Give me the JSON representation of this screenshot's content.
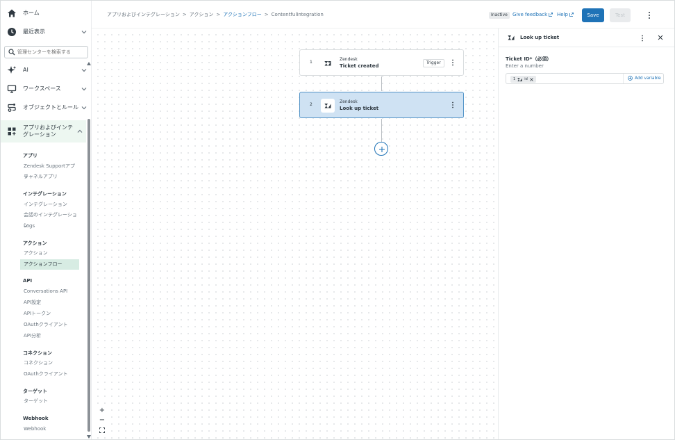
{
  "sidebar": {
    "home": "ホーム",
    "recent": "最近表示",
    "search_placeholder": "管理センターを検索する",
    "ai": "AI",
    "workspace": "ワークスペース",
    "objects": "オブジェクトとルール",
    "apps": "アプリおよびインテグレーション",
    "sections": {
      "apps_head": "アプリ",
      "apps_items": [
        "Zendesk Supportアプリ",
        "チャネルアプリ"
      ],
      "integrations_head": "インテグレーション",
      "integrations_items": [
        "インテグレーション",
        "会話のインテグレーション",
        "Logs"
      ],
      "actions_head": "アクション",
      "actions_items": [
        "アクション",
        "アクションフロー"
      ],
      "api_head": "API",
      "api_items": [
        "Conversations API",
        "API設定",
        "APIトークン",
        "OAuthクライアント",
        "API分析"
      ],
      "connections_head": "コネクション",
      "connections_items": [
        "コネクション",
        "OAuthクライアント"
      ],
      "targets_head": "ターゲット",
      "targets_items": [
        "ターゲット"
      ],
      "webhook_head": "Webhook",
      "webhook_items": [
        "Webhook"
      ]
    }
  },
  "topbar": {
    "breadcrumb": [
      "アプリおよびインテグレーション",
      "アクション",
      "アクションフロー",
      "ContentfulIntegration"
    ],
    "status": "Inactive",
    "feedback": "Give feedback",
    "help": "Help",
    "save": "Save",
    "test": "Test"
  },
  "flow": {
    "steps": [
      {
        "num": "1",
        "app": "Zendesk",
        "name": "Ticket created",
        "tag": "Trigger"
      },
      {
        "num": "2",
        "app": "Zendesk",
        "name": "Look up ticket"
      }
    ],
    "zoom_in": "+",
    "zoom_out": "−"
  },
  "panel": {
    "title": "Look up ticket",
    "field_label": "Ticket ID*（必須）",
    "field_hint": "Enter a number",
    "pill_num": "1",
    "pill_text": "id",
    "add_variable": "Add variable"
  },
  "colors": {
    "accent": "#1f73b7",
    "active_nav": "#edf7f1",
    "selected_step": "#cfe2f3"
  }
}
